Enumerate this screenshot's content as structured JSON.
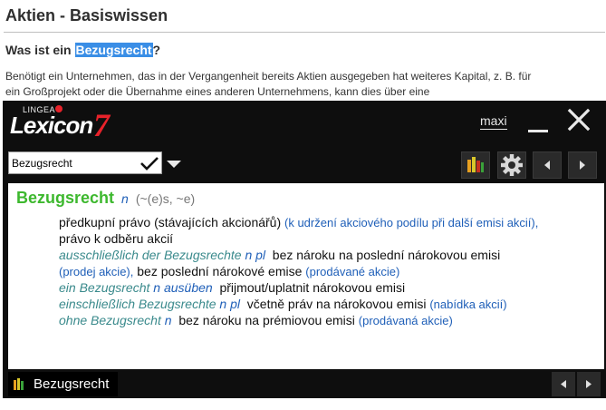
{
  "article": {
    "title": "Aktien - Basiswissen",
    "question_prefix": "Was ist ein ",
    "question_highlight": "Bezugsrecht",
    "question_suffix": "?",
    "body_line1": "Benötigt ein Unternehmen, das in der Vergangenheit bereits Aktien ausgegeben hat weiteres Kapital, z. B. für",
    "body_line2": "ein Großprojekt oder die Übernahme eines anderen Unternehmens, kann dies über eine"
  },
  "lexicon": {
    "brand_small": "LINGEA",
    "brand_name": "Lexicon",
    "brand_version": "7",
    "maxi_label": "maxi",
    "search_value": "Bezugsrecht",
    "icons": {
      "check": "checkmark-icon",
      "dropdown": "dropdown-triangle-icon",
      "books": "dictionaries-icon",
      "gear": "gear-icon",
      "prev": "chevron-left-icon",
      "next": "chevron-right-icon",
      "close": "close-icon",
      "minimize": "minimize-icon"
    },
    "entry": {
      "headword": "Bezugsrecht",
      "pos": "n",
      "grammar": "(~(e)s, ~e)",
      "sense1_tr": "předkupní právo (stávajících akcionářů)",
      "sense1_note": "(k udržení akciového podílu při další emisi akcií),",
      "sense2_tr": "právo k odběru akcií",
      "ex1_de": "ausschließlich der Bezugsrechte",
      "ex1_pos": "n pl",
      "ex1_tr": "bez nároku na poslední nárokovou emisi",
      "ex1_note_a": "(prodej akcie),",
      "ex1_tr_b": "bez poslední nárokové emise",
      "ex1_note_b": "(prodávané akcie)",
      "ex2_de": "ein Bezugsrecht",
      "ex2_pos": "n ausüben",
      "ex2_tr": "přijmout/uplatnit nárokovou emisi",
      "ex3_de": "einschließlich Bezugsrechte",
      "ex3_pos": "n pl",
      "ex3_tr": "včetně práv na nárokovou emisi",
      "ex3_note": "(nabídka akcií)",
      "ex4_de": "ohne Bezugsrecht",
      "ex4_pos": "n",
      "ex4_tr": "bez nároku na prémiovou emisi",
      "ex4_note": "(prodávaná akcie)"
    },
    "status_tab_label": "Bezugsrecht"
  },
  "colors": {
    "headword": "#3db82e",
    "pos": "#1f5fb8",
    "example": "#3a8a8c",
    "brand_red": "#e8222a",
    "highlight": "#3a8ee6"
  }
}
